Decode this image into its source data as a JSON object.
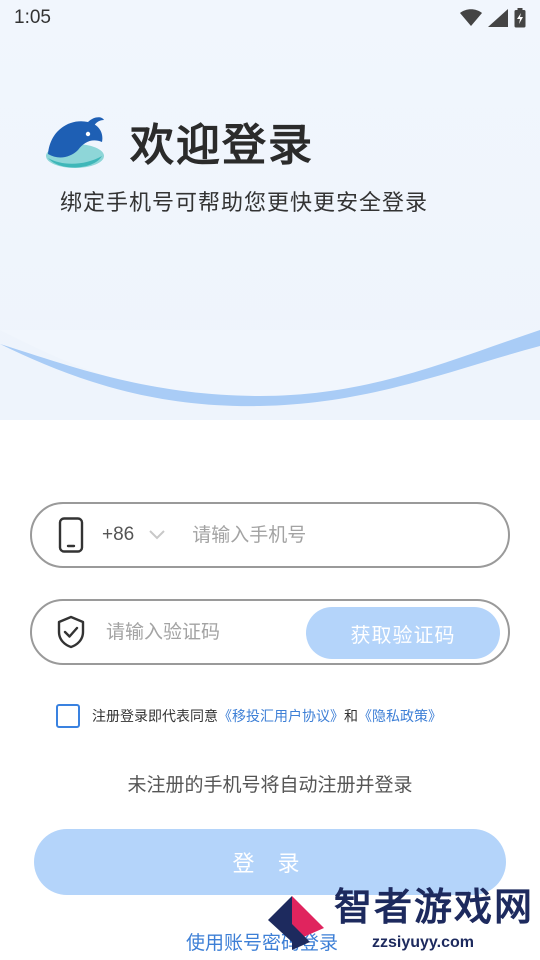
{
  "status_bar": {
    "time": "1:05",
    "icons": [
      "wifi-icon",
      "cell-signal-icon",
      "battery-charging-icon"
    ]
  },
  "header": {
    "title": "欢迎登录",
    "subtitle": "绑定手机号可帮助您更快更安全登录",
    "logo_icon": "whale-logo-icon"
  },
  "phone_field": {
    "country_code": "+86",
    "placeholder": "请输入手机号",
    "value": ""
  },
  "code_field": {
    "placeholder": "请输入验证码",
    "value": "",
    "get_code_label": "获取验证码"
  },
  "agreement": {
    "checked": false,
    "prefix": "注册登录即代表同意",
    "user_agreement": "《移投汇用户协议》",
    "conjunction": "和",
    "privacy_policy": "《隐私政策》"
  },
  "hint": "未注册的手机号将自动注册并登录",
  "login_button": "登 录",
  "account_login_link": "使用账号密码登录",
  "watermark": {
    "text": "智者游戏网",
    "sub": "zzsiyuyy.com"
  },
  "colors": {
    "accent": "#3d7fd6",
    "button_disabled": "#b4d4fa",
    "wave": "#a9ccf6",
    "hero_bg": "#f1f6fd"
  }
}
